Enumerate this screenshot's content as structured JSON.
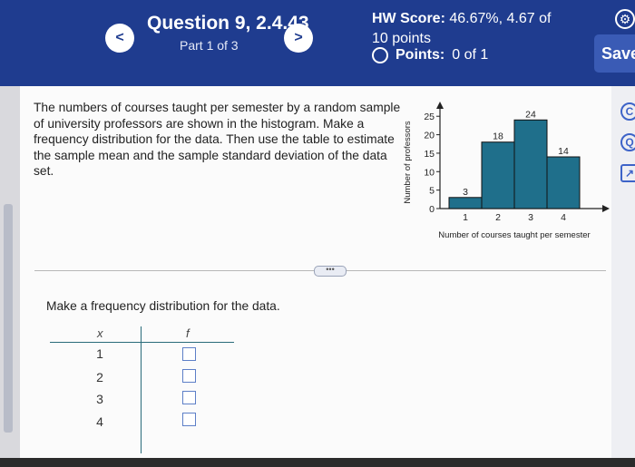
{
  "header": {
    "prev_label": "<",
    "next_label": ">",
    "question_title": "Question 9, 2.4.43",
    "part": "Part 1 of 3",
    "hw_score_label": "HW Score:",
    "hw_score_value": "46.67%, 4.67 of 10 points",
    "points_label": "Points:",
    "points_value": "0 of 1",
    "save_label": "Save"
  },
  "question": {
    "text": "The numbers of courses taught per semester by a random sample of university professors are shown in the histogram. Make a frequency distribution for the data. Then use the table to estimate the sample mean and the sample standard deviation of the data set."
  },
  "more_label": "•••",
  "freq": {
    "heading": "Make a frequency distribution for the data.",
    "col_x": "x",
    "col_f": "f",
    "rows": [
      {
        "x": "1",
        "f": ""
      },
      {
        "x": "2",
        "f": ""
      },
      {
        "x": "3",
        "f": ""
      },
      {
        "x": "4",
        "f": ""
      }
    ]
  },
  "chart_data": {
    "type": "bar",
    "categories": [
      "1",
      "2",
      "3",
      "4"
    ],
    "values": [
      3,
      18,
      24,
      14
    ],
    "data_labels": [
      "3",
      "18",
      "24",
      "14"
    ],
    "xlabel": "Number of courses taught per semester",
    "ylabel": "Number of professors",
    "yticks": [
      0,
      5,
      10,
      15,
      20,
      25
    ],
    "ylim": [
      0,
      28
    ],
    "grid": false,
    "bar_color": "#1f6f8b"
  },
  "colors": {
    "header_bg": "#1f3c8f",
    "accent": "#3d63c8"
  }
}
